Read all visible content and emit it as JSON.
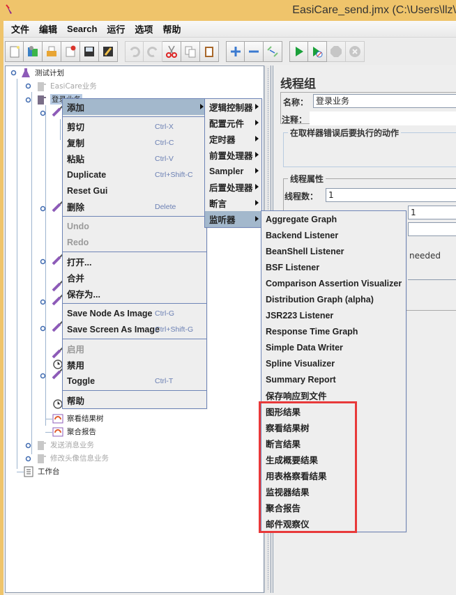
{
  "window": {
    "title": "EasiCare_send.jmx (C:\\Users\\llz\\"
  },
  "menubar": [
    {
      "label": "文件"
    },
    {
      "label": "编辑"
    },
    {
      "label": "Search"
    },
    {
      "label": "运行"
    },
    {
      "label": "选项"
    },
    {
      "label": "帮助"
    }
  ],
  "toolbar": [
    {
      "icon": "new-file-icon",
      "enabled": true
    },
    {
      "icon": "templates-icon",
      "enabled": true
    },
    {
      "icon": "open-folder-icon",
      "enabled": true
    },
    {
      "icon": "close-file-icon",
      "enabled": true
    },
    {
      "icon": "save-icon",
      "enabled": true
    },
    {
      "icon": "save-as-icon",
      "enabled": true
    },
    {
      "icon": "undo-icon",
      "enabled": false
    },
    {
      "icon": "redo-icon",
      "enabled": false
    },
    {
      "icon": "cut-icon",
      "enabled": true
    },
    {
      "icon": "copy-icon",
      "enabled": true
    },
    {
      "icon": "paste-icon",
      "enabled": true
    },
    {
      "icon": "expand-icon",
      "enabled": true
    },
    {
      "icon": "collapse-icon",
      "enabled": true
    },
    {
      "icon": "toggle-icon",
      "enabled": true
    },
    {
      "icon": "start-icon",
      "enabled": true
    },
    {
      "icon": "start-no-pause-icon",
      "enabled": true
    },
    {
      "icon": "stop-icon",
      "enabled": false
    },
    {
      "icon": "shutdown-icon",
      "enabled": false
    }
  ],
  "tree": {
    "nodes": [
      {
        "label": "测试计划",
        "icon": "test-plan-icon",
        "dim": false
      },
      {
        "label": "EasiCare业务",
        "icon": "thread-group-icon",
        "dim": true
      },
      {
        "label": "登录业务",
        "icon": "thread-group-icon",
        "dim": false,
        "selected": true
      },
      {
        "label": "察看结果树",
        "icon": "listener-icon",
        "dim": false
      },
      {
        "label": "聚合报告",
        "icon": "listener-icon",
        "dim": false
      },
      {
        "label": "发送消息业务",
        "icon": "thread-group-icon",
        "dim": true
      },
      {
        "label": "修改头像信息业务",
        "icon": "thread-group-icon",
        "dim": true
      },
      {
        "label": "工作台",
        "icon": "workbench-icon",
        "dim": false
      }
    ]
  },
  "right_panel": {
    "title": "线程组",
    "name_label": "名称：",
    "name_value": "登录业务",
    "comment_label": "注释：",
    "comment_value": "",
    "error_action_group": "在取样器错误后要执行的动作",
    "thread_props_group": "线程属性",
    "threads_label": "线程数：",
    "threads_value": "1",
    "rampup_value": "1",
    "partial_text": "needed"
  },
  "context_menu": {
    "items": [
      {
        "label": "添加",
        "submenu": true,
        "active": true
      },
      {
        "sep": true
      },
      {
        "label": "剪切",
        "shortcut": "Ctrl-X"
      },
      {
        "label": "复制",
        "shortcut": "Ctrl-C"
      },
      {
        "label": "粘贴",
        "shortcut": "Ctrl-V"
      },
      {
        "label": "Duplicate",
        "shortcut": "Ctrl+Shift-C"
      },
      {
        "label": "Reset Gui"
      },
      {
        "label": "删除",
        "shortcut": "Delete"
      },
      {
        "sep": true
      },
      {
        "label": "Undo",
        "disabled": true
      },
      {
        "label": "Redo",
        "disabled": true
      },
      {
        "sep": true
      },
      {
        "label": "打开..."
      },
      {
        "label": "合并"
      },
      {
        "label": "保存为..."
      },
      {
        "sep": true
      },
      {
        "label": "Save Node As Image",
        "shortcut": "Ctrl-G"
      },
      {
        "label": "Save Screen As Image",
        "shortcut": "Ctrl+Shift-G"
      },
      {
        "sep": true
      },
      {
        "label": "启用",
        "disabled": true
      },
      {
        "label": "禁用"
      },
      {
        "label": "Toggle",
        "shortcut": "Ctrl-T"
      },
      {
        "sep": true
      },
      {
        "label": "帮助"
      }
    ]
  },
  "add_submenu": {
    "items": [
      {
        "label": "逻辑控制器"
      },
      {
        "label": "配置元件"
      },
      {
        "label": "定时器"
      },
      {
        "label": "前置处理器"
      },
      {
        "label": "Sampler"
      },
      {
        "label": "后置处理器"
      },
      {
        "label": "断言"
      },
      {
        "label": "监听器",
        "active": true
      }
    ]
  },
  "listener_submenu": {
    "items": [
      {
        "label": "Aggregate Graph"
      },
      {
        "label": "Backend Listener"
      },
      {
        "label": "BeanShell Listener"
      },
      {
        "label": "BSF Listener"
      },
      {
        "label": "Comparison Assertion Visualizer"
      },
      {
        "label": "Distribution Graph (alpha)"
      },
      {
        "label": "JSR223 Listener"
      },
      {
        "label": "Response Time Graph"
      },
      {
        "label": "Simple Data Writer"
      },
      {
        "label": "Spline Visualizer"
      },
      {
        "label": "Summary Report"
      },
      {
        "label": "保存响应到文件"
      },
      {
        "label": "图形结果"
      },
      {
        "label": "察看结果树"
      },
      {
        "label": "断言结果"
      },
      {
        "label": "生成概要结果"
      },
      {
        "label": "用表格察看结果"
      },
      {
        "label": "监视器结果"
      },
      {
        "label": "聚合报告"
      },
      {
        "label": "邮件观察仪"
      }
    ]
  },
  "colors": {
    "title_bar": "#efc46b",
    "menu_active": "#a3b8cc",
    "menu_border": "#6e84b6",
    "highlight_box": "#e8393a",
    "shortcut_text": "#6a7fb3"
  }
}
